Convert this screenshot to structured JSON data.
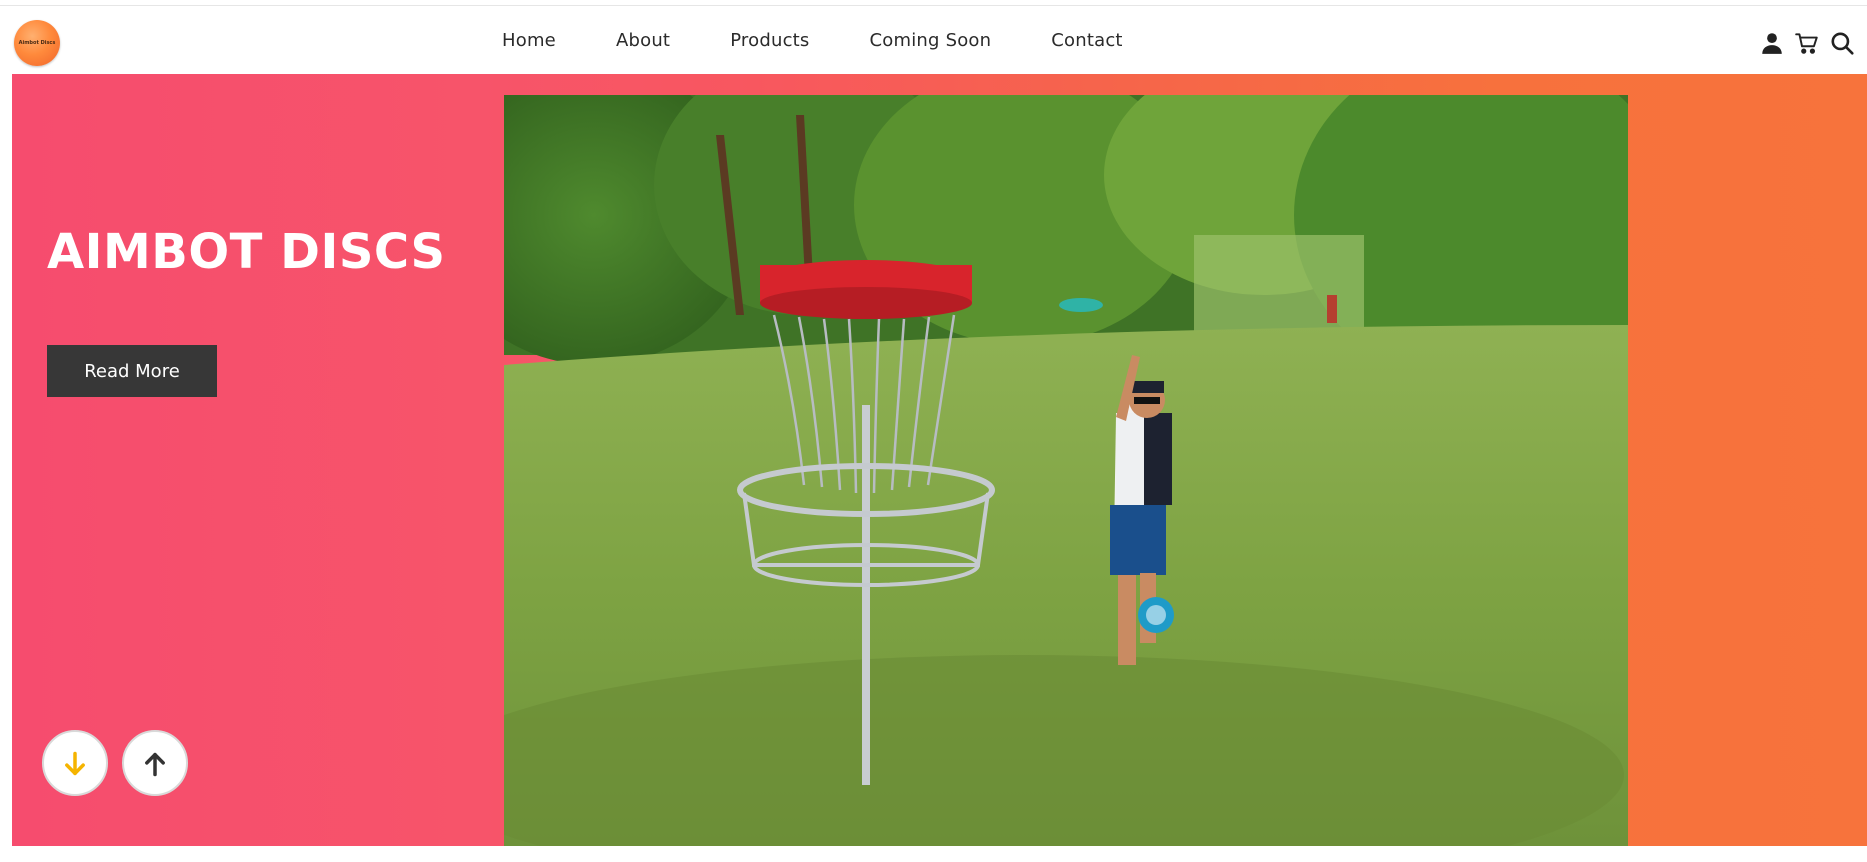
{
  "brand": {
    "logo_text": "Aimbot Discs",
    "logo_color": "#ff8a3c"
  },
  "nav": {
    "items": [
      {
        "label": "Home"
      },
      {
        "label": "About"
      },
      {
        "label": "Products"
      },
      {
        "label": "Coming Soon"
      },
      {
        "label": "Contact"
      }
    ]
  },
  "header_icons": [
    "user-icon",
    "cart-icon",
    "search-icon"
  ],
  "hero": {
    "title": "AIMBOT DISCS",
    "button_label": "Read More",
    "gradient_start": "#f64c6e",
    "gradient_end": "#f7733c",
    "image_description_icon": "disc-golf-photo"
  },
  "scroll_controls": {
    "down_icon": "arrow-down-icon",
    "up_icon": "arrow-up-icon",
    "down_color": "#f5b400",
    "up_color": "#333333"
  }
}
